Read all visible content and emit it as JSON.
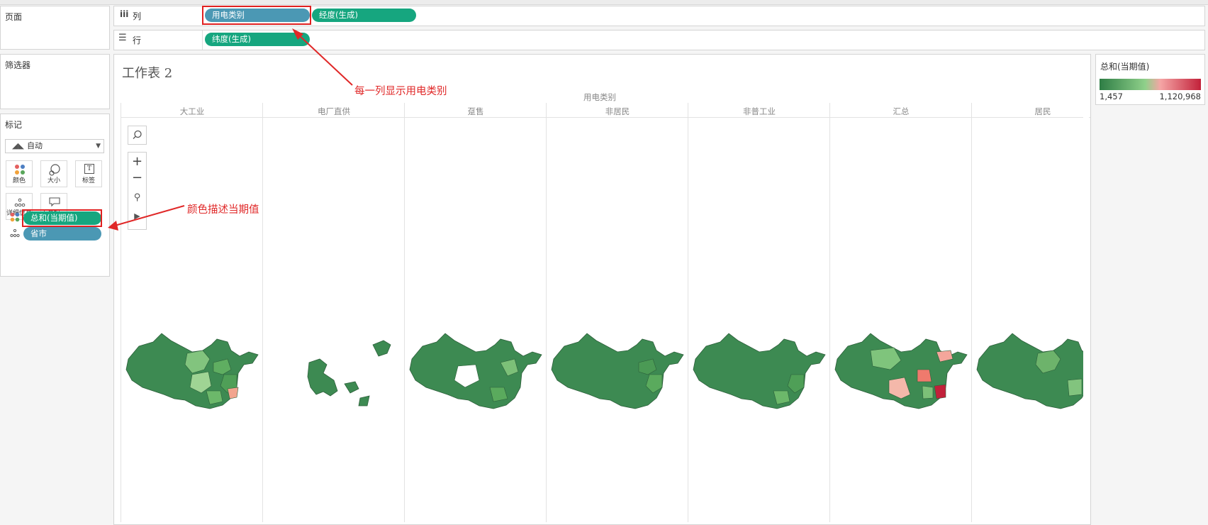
{
  "pages_panel": {
    "title": "页面"
  },
  "filters_panel": {
    "title": "筛选器"
  },
  "shelves": {
    "columns": {
      "label": "列",
      "pills": [
        "用电类别",
        "经度(生成)"
      ]
    },
    "rows": {
      "label": "行",
      "pills": [
        "纬度(生成)"
      ]
    }
  },
  "marks": {
    "title": "标记",
    "type": "自动",
    "buttons": [
      "颜色",
      "大小",
      "标签",
      "详细信息",
      "工具提示"
    ],
    "fields": [
      "总和(当期值)",
      "省市"
    ]
  },
  "worksheet": {
    "title": "工作表 2",
    "header": "用电类别",
    "columns": [
      "大工业",
      "电厂直供",
      "趸售",
      "非居民",
      "非普工业",
      "汇总",
      "居民"
    ]
  },
  "legend": {
    "title": "总和(当期值)",
    "min": "1,457",
    "max": "1,120,968",
    "colors": [
      "#2e7d45",
      "#8fd08a",
      "#f5a5a5",
      "#c2213a"
    ]
  },
  "annotations": {
    "columns_note": "每一列显示用电类别",
    "color_note": "颜色描述当期值"
  },
  "icons": {
    "columns_shelf": "columns-icon",
    "rows_shelf": "rows-icon",
    "search": "search-icon",
    "zoom_in": "plus-icon",
    "zoom_out": "minus-icon",
    "pin": "pin-icon",
    "play": "play-icon"
  }
}
